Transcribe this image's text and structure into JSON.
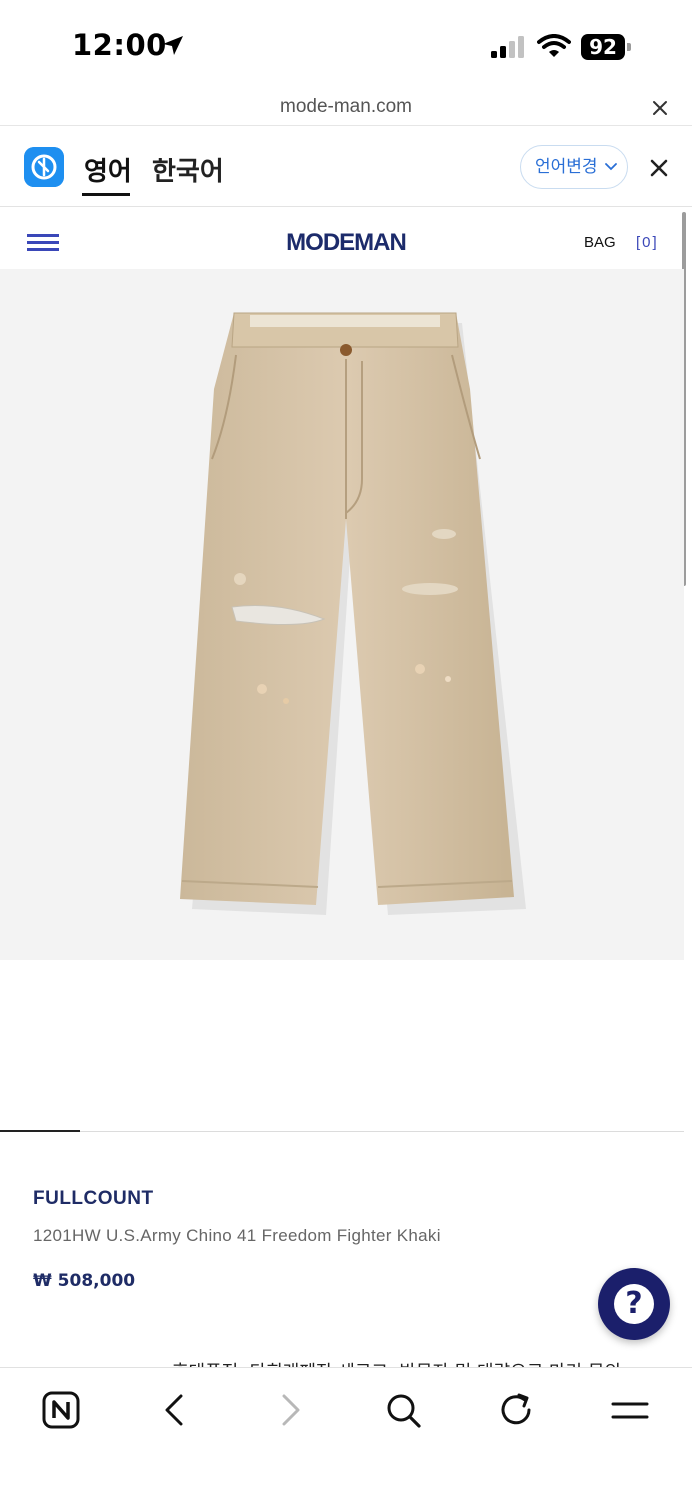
{
  "status_bar": {
    "time": "12:00",
    "battery": "92",
    "icons": [
      "location-arrow-icon",
      "signal-icon",
      "wifi-icon",
      "battery-icon"
    ]
  },
  "url_bar": {
    "url": "mode-man.com"
  },
  "translate_bar": {
    "lang_en": "영어",
    "lang_ko": "한국어",
    "change_label": "언어변경"
  },
  "site_header": {
    "logo": "MODEMAN",
    "bag_label": "BAG",
    "bag_count": "[0]",
    "accent_color": "#1f2c66"
  },
  "product": {
    "brand": "FULLCOUNT",
    "name": "1201HW U.S.Army Chino 41 Freedom Fighter Khaki",
    "price": "₩ 508,000",
    "image_name": "khaki-chino-pants"
  },
  "footer_partial_text": "휴대폰정, 타회래폐장 세로고, 방문자 및 대량으로 마리 문의",
  "toolbar": {
    "buttons": [
      "naver-home-icon",
      "back-icon",
      "forward-icon",
      "search-icon",
      "refresh-icon",
      "menu-icon"
    ]
  }
}
